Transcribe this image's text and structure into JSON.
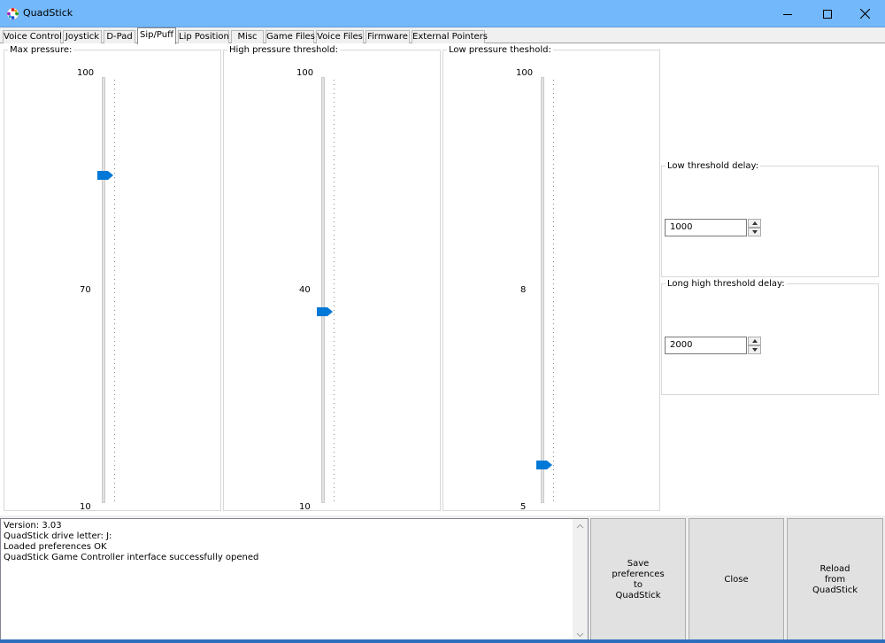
{
  "window": {
    "title": "QuadStick",
    "minimize_icon": "minimize-icon",
    "maximize_icon": "maximize-icon",
    "close_icon": "close-icon"
  },
  "tabs": [
    {
      "label": "Voice Control",
      "active": false
    },
    {
      "label": "Joystick",
      "active": false
    },
    {
      "label": "D-Pad",
      "active": false
    },
    {
      "label": "Sip/Puff",
      "active": true
    },
    {
      "label": "Lip Position",
      "active": false
    },
    {
      "label": "Misc",
      "active": false
    },
    {
      "label": "Game Files",
      "active": false
    },
    {
      "label": "Voice Files",
      "active": false
    },
    {
      "label": "Firmware",
      "active": false
    },
    {
      "label": "External Pointers",
      "active": false
    }
  ],
  "sliders": [
    {
      "legend": "Max pressure:",
      "top_label": "100",
      "mid_label": "70",
      "bottom_label": "10",
      "value": 77
    },
    {
      "legend": "High pressure threshold:",
      "top_label": "100",
      "mid_label": "40",
      "bottom_label": "10",
      "value": 45
    },
    {
      "legend": "Low pressure theshold:",
      "top_label": "100",
      "mid_label": "8",
      "bottom_label": "5",
      "value": 9
    }
  ],
  "delays": {
    "low_threshold": {
      "legend": "Low threshold delay:",
      "value": "1000"
    },
    "long_high_threshold": {
      "legend": "Long high threshold delay:",
      "value": "2000"
    }
  },
  "log": {
    "lines": [
      "Version: 3.03",
      "QuadStick drive letter: J:",
      "Loaded preferences OK",
      "QuadStick Game Controller interface successfully opened"
    ]
  },
  "buttons": {
    "save": "Save\npreferences\nto\nQuadStick",
    "close": "Close",
    "reload": "Reload\nfrom\nQuadStick"
  },
  "colors": {
    "titlebar": "#73b8fa",
    "slider_thumb": "#0078d7"
  }
}
